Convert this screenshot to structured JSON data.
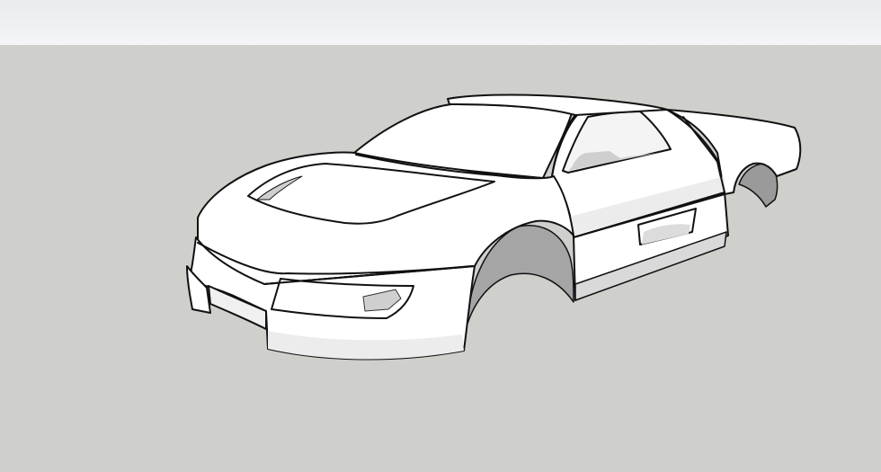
{
  "viewport": {
    "sky_color": "#eceef0",
    "ground_color": "#cfcfcb",
    "edge_color": "#111111",
    "face_color": "#ffffff",
    "shade_color": "#d8d8d8"
  },
  "model": {
    "subject": "car-body-shell"
  }
}
